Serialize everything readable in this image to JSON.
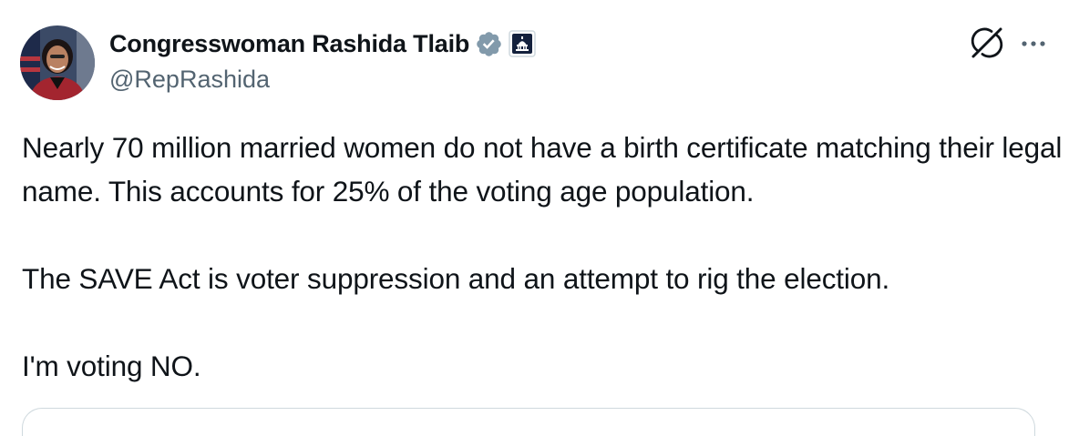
{
  "author": {
    "display_name": "Congresswoman Rashida Tlaib",
    "handle": "@RepRashida"
  },
  "icons": {
    "verified": "verified-badge-icon",
    "gov_badge": "government-affiliation-icon",
    "grok": "grok-icon",
    "more": "more-options-icon"
  },
  "colors": {
    "verified_badge": "#829aab",
    "text": "#0f1419",
    "secondary_text": "#536471",
    "card_border": "#cfd9de"
  },
  "tweet": {
    "paragraphs": [
      "Nearly 70 million married women do not have a birth certificate matching their legal name. This accounts for 25% of the voting age population.",
      "The SAVE Act is voter suppression and an attempt to rig the election.",
      "I'm voting NO."
    ]
  }
}
